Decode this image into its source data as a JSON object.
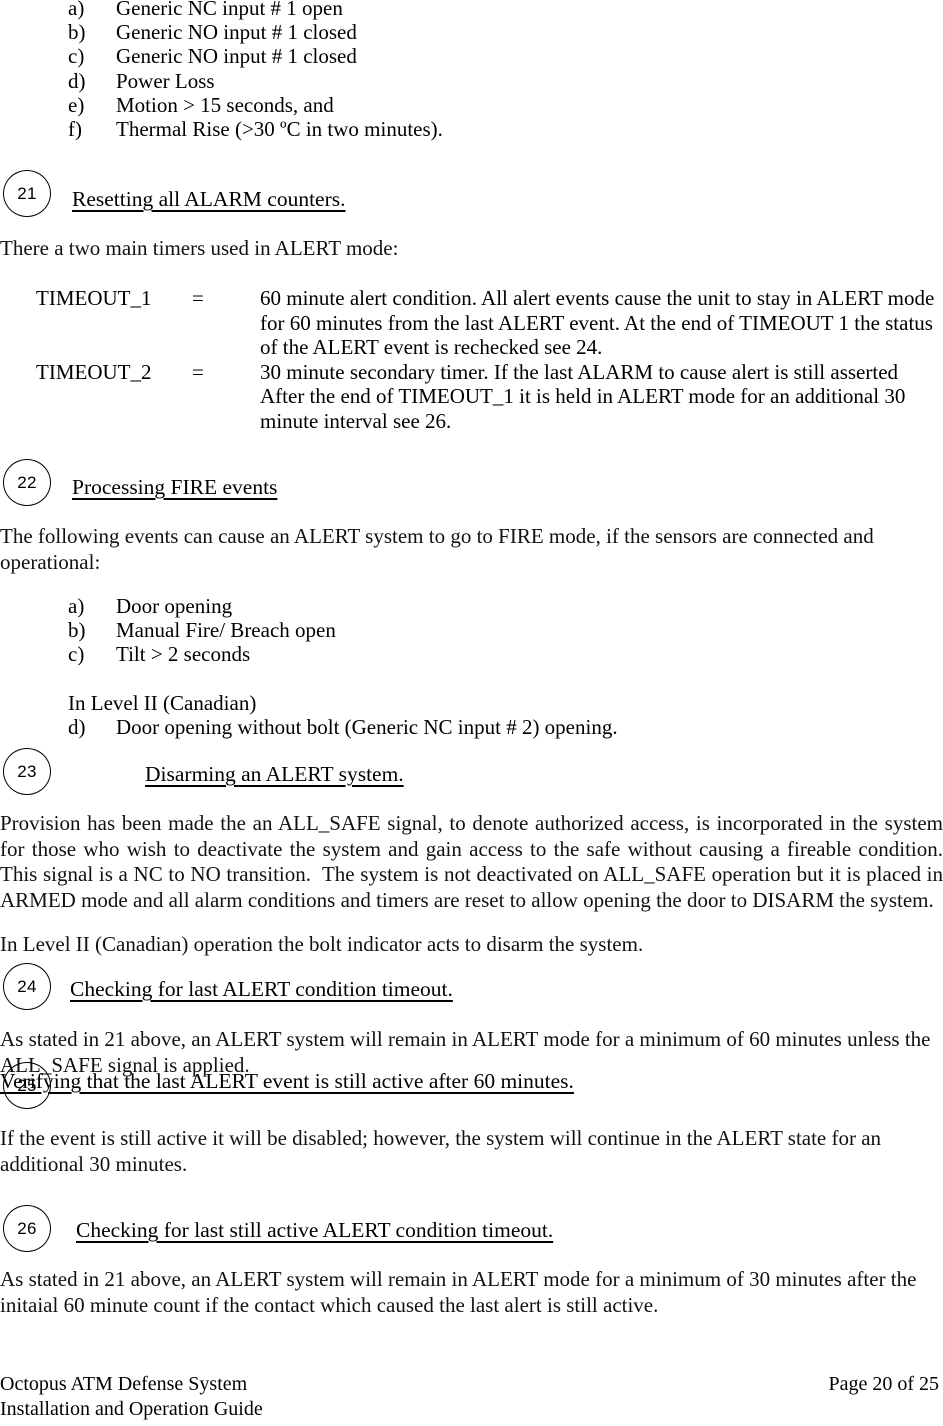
{
  "document": {
    "title": "Octopus ATM Defense System",
    "subtitle": "Installation and Operation Guide",
    "page_label": "Page 20 of 25"
  },
  "alarm_events_list": [
    {
      "marker": "a)",
      "text": "Generic NC input # 1 open"
    },
    {
      "marker": "b)",
      "text": "Generic NO input # 1 closed"
    },
    {
      "marker": "c)",
      "text": "Generic NO input # 1 closed"
    },
    {
      "marker": "d)",
      "text": "Power Loss"
    },
    {
      "marker": "e)",
      "text": "Motion > 15 seconds, and"
    },
    {
      "marker": "f)",
      "text": "Thermal Rise (>30 ºC in two minutes)."
    }
  ],
  "section_21": {
    "number": "21",
    "heading": "Resetting all ALARM counters.",
    "intro": "There a two main timers used in ALERT mode:",
    "definitions": [
      {
        "term": "TIMEOUT_1",
        "equals": "=",
        "description": "60 minute alert condition.  All alert events cause the unit to stay in ALERT mode for 60 minutes from the last ALERT event. At the end of TIMEOUT 1 the status of the ALERT event is rechecked see 24."
      },
      {
        "term": "TIMEOUT_2",
        "equals": "=",
        "description": "30 minute secondary timer.  If the last ALARM to cause alert is still asserted After the end of TIMEOUT_1 it is held in ALERT mode for an additional 30 minute interval see 26."
      }
    ]
  },
  "section_22": {
    "number": "22",
    "heading": "Processing FIRE events",
    "intro": "The following events can cause an ALERT system to go to FIRE mode, if the sensors are connected and operational:",
    "fire_events": [
      {
        "marker": "a)",
        "text": "Door opening"
      },
      {
        "marker": "b)",
        "text": "Manual Fire/ Breach open"
      },
      {
        "marker": "c)",
        "text": "Tilt > 2 seconds"
      }
    ],
    "level_note": "In Level II (Canadian)",
    "level_events": [
      {
        "marker": "d)",
        "text": "Door opening without bolt (Generic NC input # 2) opening."
      }
    ]
  },
  "section_23": {
    "number": "23",
    "heading": "Disarming an ALERT system.",
    "body": "Provision has been made the an ALL_SAFE signal, to denote authorized access, is incorporated in the system for those who wish to deactivate the system and gain access to the safe without causing a fireable condition.  This signal is a NC to NO transition.  The system is not deactivated on ALL_SAFE operation but it is placed in ARMED mode and all alarm conditions and timers are reset to allow opening the door to DISARM the system.",
    "bolt_note": "In Level II (Canadian) operation the bolt indicator acts to disarm the system."
  },
  "section_24": {
    "number": "24",
    "heading": "Checking for last ALERT condition timeout.",
    "body": "As stated in 21 above, an ALERT system will remain in ALERT mode for a minimum of 60 minutes unless the ALL_SAFE signal is applied."
  },
  "section_25": {
    "number": "25",
    "heading": "Verifying that the last ALERT event is still active after 60 minutes.",
    "body": "If the event is still active it will be disabled; however, the system will continue in the ALERT state for an additional 30 minutes."
  },
  "section_26": {
    "number": "26",
    "heading": "Checking for last still active ALERT condition timeout.",
    "body": "As stated in 21 above, an ALERT system will remain in ALERT mode for a minimum of 30 minutes after the initaial 60 minute count if the contact which caused the last alert is still active."
  }
}
